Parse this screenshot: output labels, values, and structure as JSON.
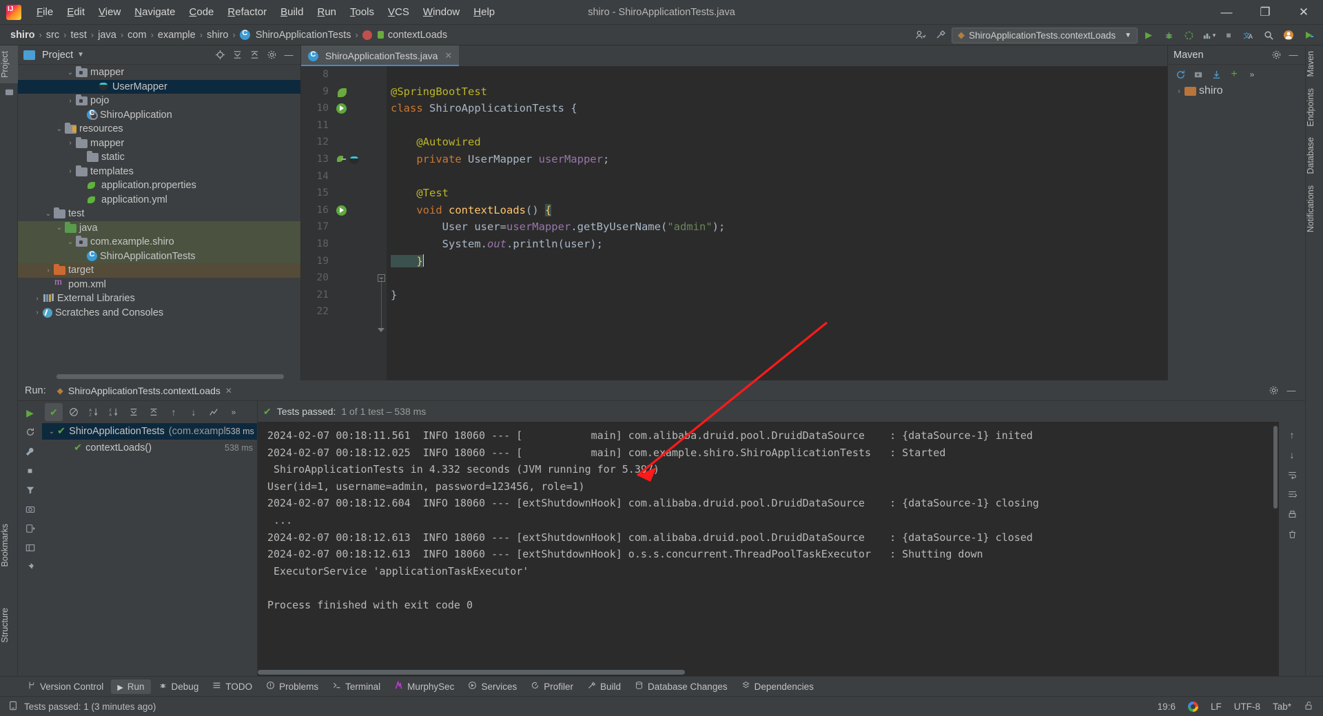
{
  "window": {
    "title": "shiro - ShiroApplicationTests.java",
    "logo": "intellij-idea-logo",
    "minimize": "—",
    "maximize": "❐",
    "close": "✕"
  },
  "menu": [
    "File",
    "Edit",
    "View",
    "Navigate",
    "Code",
    "Refactor",
    "Build",
    "Run",
    "Tools",
    "VCS",
    "Window",
    "Help"
  ],
  "breadcrumb": {
    "items": [
      "shiro",
      "src",
      "test",
      "java",
      "com",
      "example",
      "shiro",
      "ShiroApplicationTests",
      "contextLoads"
    ],
    "separator": "›"
  },
  "navbar_right": {
    "run_config": "ShiroApplicationTests.contextLoads",
    "run": "▶",
    "debug": "debug-icon",
    "run_coverage": "coverage-icon",
    "profiler": "profiler-icon",
    "stop": "■",
    "translate": "translate-icon",
    "search": "⌕",
    "account": "account-icon",
    "updates": "updates-icon"
  },
  "left_strip": {
    "project_tab": "Project",
    "bookmarks_tab": "Bookmarks",
    "structure_tab": "Structure"
  },
  "right_strip": {
    "maven_tab": "Maven",
    "endpoints_tab": "Endpoints",
    "database_tab": "Database",
    "notifications_tab": "Notifications"
  },
  "project_panel": {
    "title": "Project",
    "icons": [
      "locate-icon",
      "collapse-all-icon",
      "expand-all-icon",
      "settings-icon",
      "hide-icon"
    ],
    "tree": [
      {
        "label": "mapper",
        "indent": 4,
        "arrow": "v",
        "icon": "pkg",
        "state": "none"
      },
      {
        "label": "UserMapper",
        "indent": 6,
        "arrow": "",
        "icon": "mapper",
        "state": "selected"
      },
      {
        "label": "pojo",
        "indent": 4,
        "arrow": ">",
        "icon": "pkg",
        "state": "none"
      },
      {
        "label": "ShiroApplication",
        "indent": 5,
        "arrow": "",
        "icon": "springboot",
        "state": "none"
      },
      {
        "label": "resources",
        "indent": 3,
        "arrow": "v",
        "icon": "resources",
        "state": "none"
      },
      {
        "label": "mapper",
        "indent": 4,
        "arrow": ">",
        "icon": "folder",
        "state": "none"
      },
      {
        "label": "static",
        "indent": 5,
        "arrow": "",
        "icon": "folder",
        "state": "none"
      },
      {
        "label": "templates",
        "indent": 4,
        "arrow": ">",
        "icon": "folder",
        "state": "none"
      },
      {
        "label": "application.properties",
        "indent": 5,
        "arrow": "",
        "icon": "spring",
        "state": "none"
      },
      {
        "label": "application.yml",
        "indent": 5,
        "arrow": "",
        "icon": "spring",
        "state": "none"
      },
      {
        "label": "test",
        "indent": 2,
        "arrow": "v",
        "icon": "folder",
        "state": "none"
      },
      {
        "label": "java",
        "indent": 3,
        "arrow": "v",
        "icon": "folder-green",
        "state": "scope-green"
      },
      {
        "label": "com.example.shiro",
        "indent": 4,
        "arrow": "v",
        "icon": "pkg",
        "state": "scope-green"
      },
      {
        "label": "ShiroApplicationTests",
        "indent": 5,
        "arrow": "",
        "icon": "class-test",
        "state": "scope-green"
      },
      {
        "label": "target",
        "indent": 2,
        "arrow": ">",
        "icon": "folder-orange",
        "state": "scope-brown"
      },
      {
        "label": "pom.xml",
        "indent": 2,
        "arrow": "",
        "icon": "xml",
        "state": "none"
      },
      {
        "label": "External Libraries",
        "indent": 1,
        "arrow": ">",
        "icon": "lib",
        "state": "none"
      },
      {
        "label": "Scratches and Consoles",
        "indent": 1,
        "arrow": ">",
        "icon": "scratch",
        "state": "none"
      }
    ]
  },
  "editor": {
    "tab": {
      "label": "ShiroApplicationTests.java",
      "close": "✕",
      "icon": "class-test-icon"
    },
    "kebab": "⋮",
    "inspection_status": "✔",
    "lines": [
      {
        "n": 8,
        "tokens": []
      },
      {
        "n": 9,
        "gutter": "spring-leaf",
        "tokens": [
          {
            "t": "@SpringBootTest",
            "c": "ann"
          }
        ]
      },
      {
        "n": 10,
        "gutter": "run-arrow",
        "tokens": [
          {
            "t": "class ",
            "c": "k"
          },
          {
            "t": "ShiroApplicationTests ",
            "c": "typ"
          },
          {
            "t": "{",
            "c": "pl"
          }
        ]
      },
      {
        "n": 11,
        "tokens": []
      },
      {
        "n": 12,
        "tokens": [
          {
            "t": "    @Autowired",
            "c": "ann"
          }
        ]
      },
      {
        "n": 13,
        "gutter": "bean-mapper",
        "tokens": [
          {
            "t": "    private ",
            "c": "k"
          },
          {
            "t": "UserMapper ",
            "c": "typ"
          },
          {
            "t": "userMapper",
            "c": "fld"
          },
          {
            "t": ";",
            "c": "pl"
          }
        ]
      },
      {
        "n": 14,
        "tokens": []
      },
      {
        "n": 15,
        "tokens": [
          {
            "t": "    @Test",
            "c": "ann"
          }
        ]
      },
      {
        "n": 16,
        "gutter": "run-arrow",
        "fold": "start",
        "tokens": [
          {
            "t": "    ",
            "c": "pl"
          },
          {
            "t": "void ",
            "c": "k"
          },
          {
            "t": "contextLoads",
            "c": "mth"
          },
          {
            "t": "() ",
            "c": "pl"
          },
          {
            "t": "{",
            "c": "brace-hl"
          }
        ]
      },
      {
        "n": 17,
        "tokens": [
          {
            "t": "        User user=",
            "c": "pl"
          },
          {
            "t": "userMapper",
            "c": "fld"
          },
          {
            "t": ".",
            "c": "pl"
          },
          {
            "t": "getByUserName",
            "c": "pl"
          },
          {
            "t": "(",
            "c": "pl"
          },
          {
            "t": "\"admin\"",
            "c": "str"
          },
          {
            "t": ");",
            "c": "pl"
          }
        ]
      },
      {
        "n": 18,
        "tokens": [
          {
            "t": "        System.",
            "c": "pl"
          },
          {
            "t": "out",
            "c": "fld-i"
          },
          {
            "t": ".println(user);",
            "c": "pl"
          }
        ]
      },
      {
        "n": 19,
        "fold": "end",
        "tokens": [
          {
            "t": "    }",
            "c": "brace-hl"
          },
          {
            "t": "CARET",
            "c": "caret"
          }
        ]
      },
      {
        "n": 20,
        "tokens": []
      },
      {
        "n": 21,
        "tokens": [
          {
            "t": "}",
            "c": "pl"
          }
        ]
      },
      {
        "n": 22,
        "tokens": []
      }
    ]
  },
  "run_panel": {
    "label": "Run:",
    "tab_title": "ShiroApplicationTests.contextLoads",
    "tab_close": "✕",
    "header_icons": [
      "settings-icon",
      "hide-icon"
    ],
    "toolbar_icons": [
      "run-icon",
      "rerun-failed-icon",
      "stop-icon",
      "sort-alpha-icon",
      "sort-duration-icon",
      "expand-all-icon",
      "collapse-all-icon",
      "prev-icon",
      "next-icon",
      "history-icon",
      "more-icon"
    ],
    "status_text": "Tests passed:",
    "status_detail": "1 of 1 test – 538 ms",
    "status_count": "1",
    "tree": [
      {
        "label": "ShiroApplicationTests",
        "sub": "(com.exampl",
        "time": "538 ms",
        "selected": true,
        "level": 0
      },
      {
        "label": "contextLoads()",
        "sub": "",
        "time": "538 ms",
        "selected": false,
        "level": 1
      }
    ],
    "console_lines": [
      "2024-02-07 00:18:11.561  INFO 18060 --- [           main] com.alibaba.druid.pool.DruidDataSource    : {dataSource-1} inited",
      "2024-02-07 00:18:12.025  INFO 18060 --- [           main] com.example.shiro.ShiroApplicationTests   : Started",
      " ShiroApplicationTests in 4.332 seconds (JVM running for 5.397)",
      "User(id=1, username=admin, password=123456, role=1)",
      "2024-02-07 00:18:12.604  INFO 18060 --- [extShutdownHook] com.alibaba.druid.pool.DruidDataSource    : {dataSource-1} closing",
      " ...",
      "2024-02-07 00:18:12.613  INFO 18060 --- [extShutdownHook] com.alibaba.druid.pool.DruidDataSource    : {dataSource-1} closed",
      "2024-02-07 00:18:12.613  INFO 18060 --- [extShutdownHook] o.s.s.concurrent.ThreadPoolTaskExecutor   : Shutting down",
      " ExecutorService 'applicationTaskExecutor'",
      "",
      "Process finished with exit code 0"
    ],
    "console_side_icons": [
      "scroll-up-icon",
      "scroll-down-icon",
      "soft-wrap-icon",
      "scroll-to-end-icon",
      "print-icon",
      "clear-all-icon"
    ]
  },
  "maven_panel": {
    "title": "Maven",
    "icons": [
      "settings-icon",
      "hide-icon"
    ],
    "toolbar": [
      "reload-icon",
      "generate-sources-icon",
      "download-sources-icon",
      "add-icon",
      "more-icon"
    ],
    "tree": [
      {
        "label": "shiro",
        "arrow": ">",
        "icon": "maven-project-icon"
      }
    ]
  },
  "bottom_bar": [
    {
      "label": "Version Control",
      "icon": "branch-icon",
      "active": false
    },
    {
      "label": "Run",
      "icon": "run-icon",
      "active": true
    },
    {
      "label": "Debug",
      "icon": "debug-icon",
      "active": false
    },
    {
      "label": "TODO",
      "icon": "todo-icon",
      "active": false
    },
    {
      "label": "Problems",
      "icon": "problems-icon",
      "active": false
    },
    {
      "label": "Terminal",
      "icon": "terminal-icon",
      "active": false
    },
    {
      "label": "MurphySec",
      "icon": "murphysec-icon",
      "active": false
    },
    {
      "label": "Services",
      "icon": "services-icon",
      "active": false
    },
    {
      "label": "Profiler",
      "icon": "profiler-icon",
      "active": false
    },
    {
      "label": "Build",
      "icon": "build-icon",
      "active": false
    },
    {
      "label": "Database Changes",
      "icon": "database-changes-icon",
      "active": false
    },
    {
      "label": "Dependencies",
      "icon": "dependencies-icon",
      "active": false
    }
  ],
  "status_bar": {
    "message": "Tests passed: 1 (3 minutes ago)",
    "message_icon": "event-log-icon",
    "caret_position": "19:6",
    "google_icon": "google-translate-icon",
    "line_separator": "LF",
    "encoding": "UTF-8",
    "indent": "Tab*",
    "lock_icon": "unlocked-icon"
  },
  "colors": {
    "accent_blue": "#4a88c7",
    "selection_blue": "#0d293e",
    "scope_green": "#4b5340",
    "scope_brown": "#544b38",
    "panel_bg": "#3c3f41",
    "editor_bg": "#2b2b2b",
    "annotation_arrow": "#ff1a1a",
    "pass_green": "#5fa83f"
  }
}
